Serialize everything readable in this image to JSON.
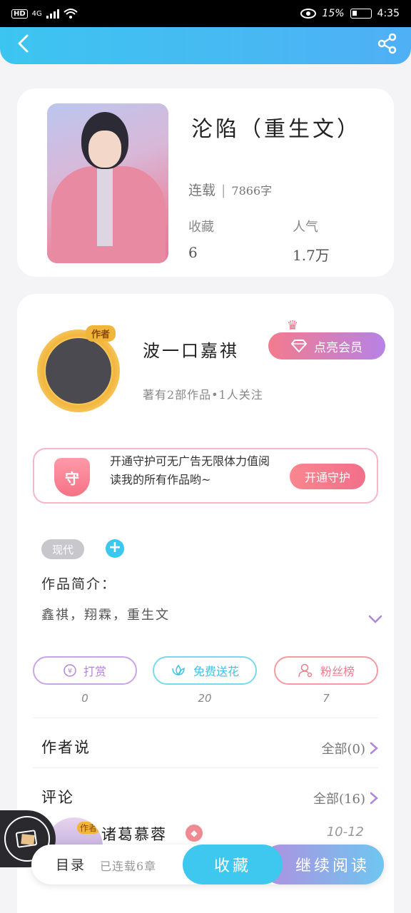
{
  "status_bar": {
    "network": "HD",
    "signal": "4G",
    "battery": "15%",
    "time": "4:35"
  },
  "book": {
    "title": "沦陷（重生文）",
    "status": "连载",
    "word_count": "7866字",
    "favorites_label": "收藏",
    "favorites_value": "6",
    "popularity_label": "人气",
    "popularity_value": "1.7万"
  },
  "author": {
    "tag": "作者",
    "name": "波一口嘉祺",
    "stats": "著有2部作品•1人关注",
    "vip_button": "点亮会员"
  },
  "guard": {
    "shield_text": "守",
    "text": "开通守护可无广告无限体力值阅读我的所有作品哟~",
    "button": "开通守护"
  },
  "tags": {
    "items": [
      "现代"
    ],
    "add": "+"
  },
  "intro": {
    "label": "作品简介：",
    "text": "鑫祺，翔霖，重生文"
  },
  "actions": [
    {
      "label": "打赏",
      "count": "0",
      "icon": "yen-icon"
    },
    {
      "label": "免费送花",
      "count": "20",
      "icon": "flower-icon"
    },
    {
      "label": "粉丝榜",
      "count": "7",
      "icon": "user-icon"
    }
  ],
  "author_says": {
    "label": "作者说",
    "link": "全部(0)"
  },
  "comments": {
    "label": "评论",
    "link": "全部(16)",
    "first": {
      "tag": "作者",
      "name": "诸葛慕蓉",
      "date": "10-12"
    }
  },
  "bottom": {
    "toc": "目录",
    "toc_sub": "已连载6章",
    "collect": "收藏",
    "read": "继续阅读"
  },
  "colors": {
    "accent": "#3cc5f0",
    "pink": "#f26f8a",
    "purple": "#b087d8"
  }
}
